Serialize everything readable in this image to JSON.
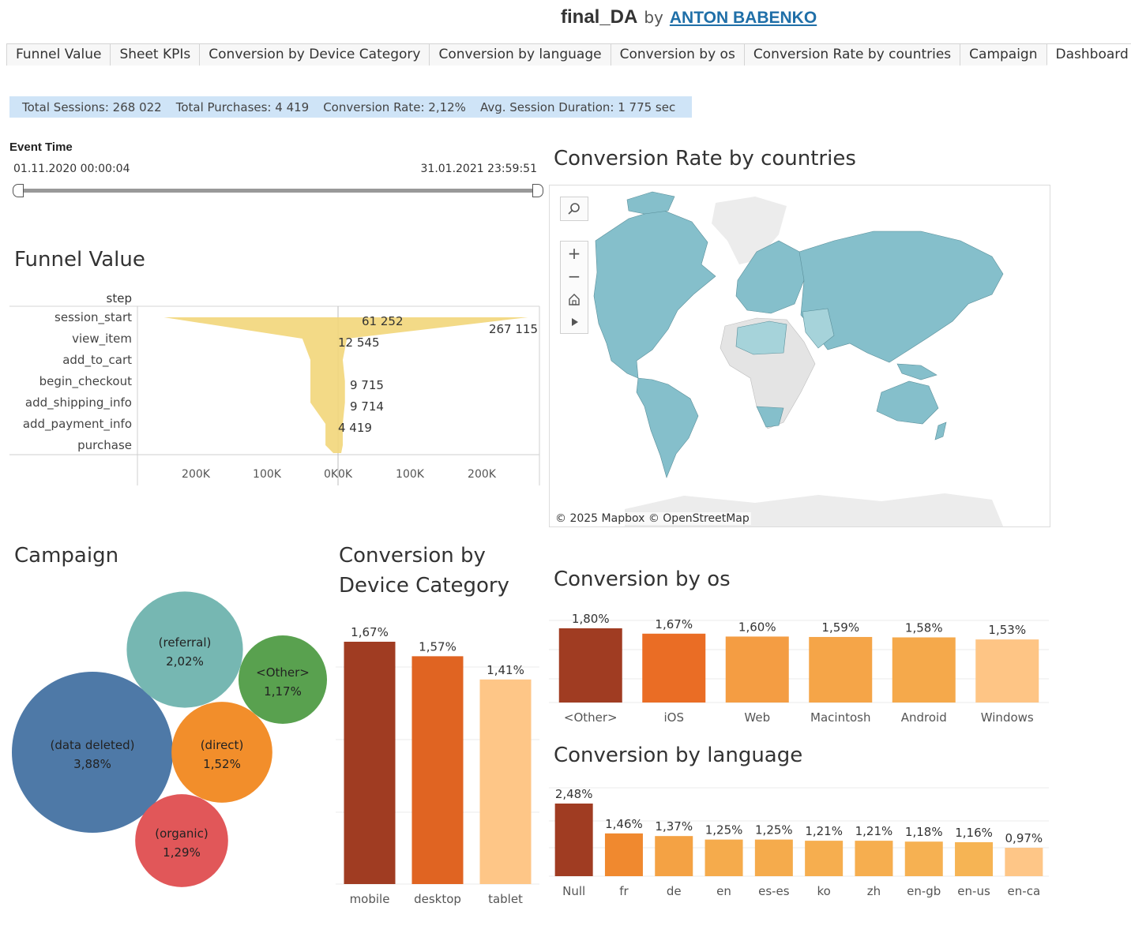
{
  "header": {
    "workbook": "final_DA",
    "by": "by",
    "author": "ANTON BABENKO"
  },
  "tabs": [
    "Funnel Value",
    "Sheet KPIs",
    "Conversion by Device Category",
    "Conversion by language",
    "Conversion by os",
    "Conversion Rate by countries",
    "Campaign",
    "Dashboard 1"
  ],
  "active_tab": "Dashboard 1",
  "kpis": {
    "sessions": "Total Sessions: 268 022",
    "purchases": "Total Purchases: 4 419",
    "conversion": "Conversion Rate: 2,12%",
    "duration": "Avg. Session Duration: 1 775 sec"
  },
  "event_time": {
    "label": "Event Time",
    "start": "01.11.2020 00:00:04",
    "end": "31.01.2021 23:59:51"
  },
  "titles": {
    "funnel": "Funnel Value",
    "countries": "Conversion Rate by countries",
    "campaign": "Campaign",
    "device_line1": "Conversion by",
    "device_line2": "Device Category",
    "os": "Conversion by os",
    "language": "Conversion by language"
  },
  "map": {
    "attribution": "© 2025 Mapbox  © OpenStreetMap",
    "controls": [
      "search-icon",
      "zoom-in-icon",
      "zoom-out-icon",
      "home-icon",
      "play-icon"
    ],
    "fill_color": "#85bfcb",
    "no_data_color": "#e4e4e4"
  },
  "chart_data": [
    {
      "type": "bar",
      "id": "funnel",
      "title": "Funnel Value",
      "ylabel": "step",
      "categories": [
        "session_start",
        "view_item",
        "add_to_cart",
        "begin_checkout",
        "add_shipping_info",
        "add_payment_info",
        "purchase"
      ],
      "right_values": [
        267115,
        12545,
        0,
        9715,
        9714,
        0,
        4419
      ],
      "left_values": [
        61252,
        12545,
        9715,
        9715,
        9714,
        4419,
        4419
      ],
      "labels": [
        {
          "text": "61 252",
          "step": 0,
          "side": "center"
        },
        {
          "text": "267 115",
          "step": 0,
          "side": "right"
        },
        {
          "text": "12 545",
          "step": 1,
          "side": "center"
        },
        {
          "text": "9 715",
          "step": 3,
          "side": "center"
        },
        {
          "text": "9 714",
          "step": 4,
          "side": "center"
        },
        {
          "text": "4 419",
          "step": 5,
          "side": "center"
        }
      ],
      "x_ticks": [
        "200K",
        "100K",
        "0K",
        "0K",
        "100K",
        "200K"
      ],
      "color": "#f2d67a"
    },
    {
      "type": "scatter",
      "id": "campaign",
      "title": "Campaign",
      "bubbles": [
        {
          "name": "(data deleted)",
          "label": "3,88%",
          "value": 3.88,
          "color": "#4e79a7"
        },
        {
          "name": "(referral)",
          "label": "2,02%",
          "value": 2.02,
          "color": "#76b7b2"
        },
        {
          "name": "(direct)",
          "label": "1,52%",
          "value": 1.52,
          "color": "#f28e2b"
        },
        {
          "name": "(organic)",
          "label": "1,29%",
          "value": 1.29,
          "color": "#e15759"
        },
        {
          "name": "<Other>",
          "label": "1,17%",
          "value": 1.17,
          "color": "#59a14f"
        }
      ]
    },
    {
      "type": "bar",
      "id": "device",
      "title": "Conversion by Device Category",
      "categories": [
        "mobile",
        "desktop",
        "tablet"
      ],
      "values": [
        1.67,
        1.57,
        1.41
      ],
      "labels": [
        "1,67%",
        "1,57%",
        "1,41%"
      ],
      "colors": [
        "#a03c22",
        "#e06422",
        "#fec687"
      ]
    },
    {
      "type": "bar",
      "id": "os",
      "title": "Conversion by os",
      "categories": [
        "<Other>",
        "iOS",
        "Web",
        "Macintosh",
        "Android",
        "Windows"
      ],
      "values": [
        1.8,
        1.67,
        1.6,
        1.59,
        1.58,
        1.53
      ],
      "labels": [
        "1,80%",
        "1,67%",
        "1,60%",
        "1,59%",
        "1,58%",
        "1,53%"
      ],
      "colors": [
        "#a03c22",
        "#ea6d25",
        "#f49d43",
        "#f5a548",
        "#f5a94b",
        "#fec585"
      ]
    },
    {
      "type": "bar",
      "id": "language",
      "title": "Conversion by language",
      "categories": [
        "Null",
        "fr",
        "de",
        "en",
        "es-es",
        "ko",
        "zh",
        "en-gb",
        "en-us",
        "en-ca"
      ],
      "values": [
        2.48,
        1.46,
        1.37,
        1.25,
        1.25,
        1.21,
        1.21,
        1.18,
        1.16,
        0.97
      ],
      "labels": [
        "2,48%",
        "1,46%",
        "1,37%",
        "1,25%",
        "1,25%",
        "1,21%",
        "1,21%",
        "1,18%",
        "1,16%",
        "0,97%"
      ],
      "colors": [
        "#a03c22",
        "#f0892f",
        "#f4a244",
        "#f5ab4c",
        "#f5ab4c",
        "#f6ae4f",
        "#f6ae4f",
        "#f6b152",
        "#f6b454",
        "#fec687"
      ]
    }
  ]
}
